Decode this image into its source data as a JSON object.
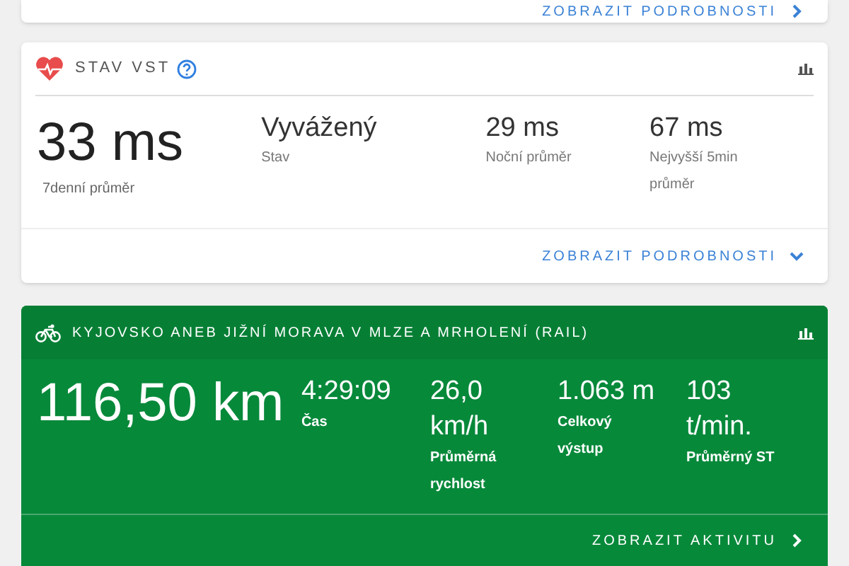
{
  "top_card": {
    "link": "ZOBRAZIT PODROBNOSTI"
  },
  "hrv_card": {
    "title": "STAV VST",
    "main": {
      "value": "33 ms",
      "label": "7denní průměr"
    },
    "stats": [
      {
        "value": "Vyvážený",
        "label": "Stav"
      },
      {
        "value": "29 ms",
        "label": "Noční průměr"
      },
      {
        "value": "67 ms",
        "label": "Nejvyšší 5min průměr"
      }
    ],
    "link": "ZOBRAZIT PODROBNOSTI"
  },
  "activity_card": {
    "title": "KYJOVSKO ANEB JIŽNÍ MORAVA V MLZE A MRHOLENÍ (RAIL)",
    "main": {
      "value": "116,50 km"
    },
    "stats": [
      {
        "value": "4:29:09",
        "label": "Čas"
      },
      {
        "value": "26,0 km/h",
        "label": "Průměrná rychlost"
      },
      {
        "value": "1.063 m",
        "label": "Celkový výstup"
      },
      {
        "value": "103 t/min.",
        "label": "Průměrný ST"
      }
    ],
    "link": "ZOBRAZIT AKTIVITU"
  }
}
